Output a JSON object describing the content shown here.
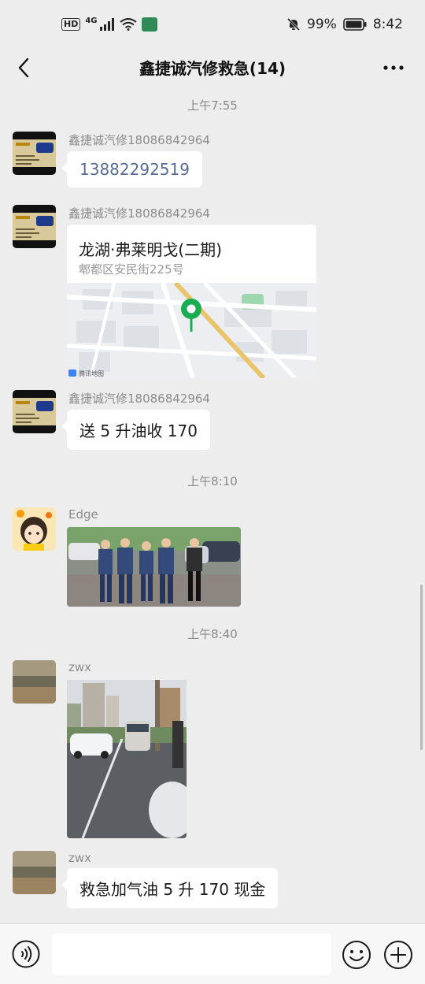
{
  "status_bar": {
    "hd": "HD",
    "network": "4G",
    "battery": "99%",
    "time": "8:42"
  },
  "header": {
    "title": "鑫捷诚汽修救急(14)"
  },
  "timestamps": [
    "上午7:55",
    "上午8:10",
    "上午8:40"
  ],
  "messages": [
    {
      "sender": "鑫捷诚汽修18086842964",
      "text": "13882292519",
      "type": "phone"
    },
    {
      "sender": "鑫捷诚汽修18086842964",
      "type": "location",
      "location_name": "龙湖·弗莱明戈(二期)",
      "location_address": "郫都区安民街225号",
      "map_label": "腾讯地图"
    },
    {
      "sender": "鑫捷诚汽修18086842964",
      "text": "送 5 升油收 170",
      "type": "text"
    },
    {
      "sender": "Edge",
      "type": "image",
      "description": "group-photo"
    },
    {
      "sender": "zwx",
      "type": "image",
      "description": "street-photo"
    },
    {
      "sender": "zwx",
      "text": "救急加气油 5 升 170 现金",
      "type": "text"
    }
  ],
  "icons": {
    "back": "back-arrow-icon",
    "more": "more-icon",
    "voice": "voice-icon",
    "emoji": "emoji-icon",
    "plus": "plus-icon"
  },
  "colors": {
    "background": "#ededed",
    "bubble": "#ffffff",
    "link": "#576b95",
    "map_pin": "#1aad52"
  }
}
